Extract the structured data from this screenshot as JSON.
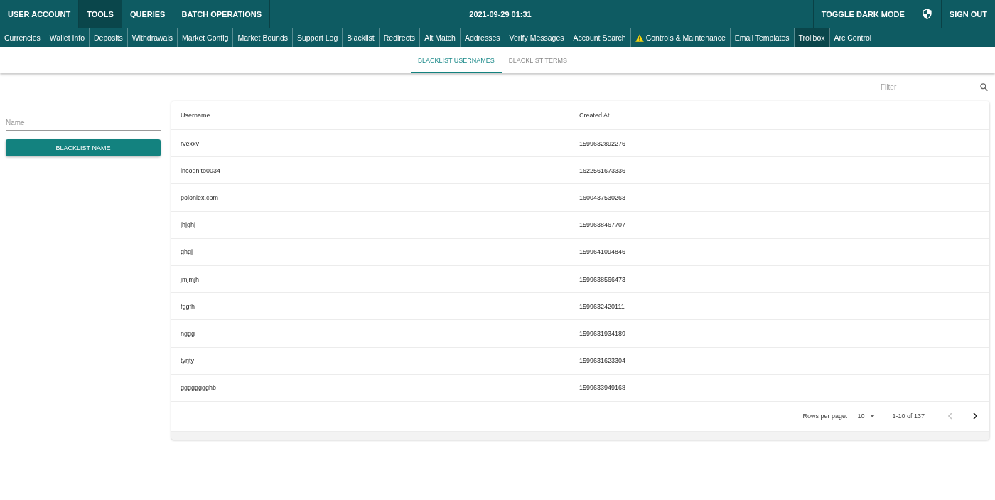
{
  "top_nav": {
    "items": [
      {
        "label": "USER ACCOUNT",
        "selected": false
      },
      {
        "label": "TOOLS",
        "selected": true
      },
      {
        "label": "QUERIES",
        "selected": false
      },
      {
        "label": "BATCH OPERATIONS",
        "selected": false
      }
    ],
    "datetime": "2021-09-29 01:31",
    "actions": [
      {
        "kind": "text",
        "label": "TOGGLE DARK MODE"
      },
      {
        "kind": "icon"
      },
      {
        "kind": "text",
        "label": "SIGN OUT"
      }
    ]
  },
  "sub_nav": {
    "items": [
      {
        "label": "Currencies",
        "selected": false,
        "alert": false
      },
      {
        "label": "Wallet Info",
        "selected": false,
        "alert": false
      },
      {
        "label": "Deposits",
        "selected": false,
        "alert": false
      },
      {
        "label": "Withdrawals",
        "selected": false,
        "alert": false
      },
      {
        "label": "Market Config",
        "selected": false,
        "alert": false
      },
      {
        "label": "Market Bounds",
        "selected": false,
        "alert": false
      },
      {
        "label": "Support Log",
        "selected": false,
        "alert": false
      },
      {
        "label": "Blacklist",
        "selected": false,
        "alert": false
      },
      {
        "label": "Redirects",
        "selected": false,
        "alert": false
      },
      {
        "label": "Alt Match",
        "selected": false,
        "alert": false
      },
      {
        "label": "Addresses",
        "selected": false,
        "alert": false
      },
      {
        "label": "Verify Messages",
        "selected": false,
        "alert": false
      },
      {
        "label": "Account Search",
        "selected": false,
        "alert": false
      },
      {
        "label": "Controls & Maintenance",
        "selected": false,
        "alert": true
      },
      {
        "label": "Email Templates",
        "selected": false,
        "alert": false
      },
      {
        "label": "Trollbox",
        "selected": true,
        "alert": false
      },
      {
        "label": "Arc Control",
        "selected": false,
        "alert": false
      }
    ]
  },
  "tabs": [
    {
      "label": "BLACKLIST USERNAMES",
      "selected": true
    },
    {
      "label": "BLACKLIST TERMS",
      "selected": false
    }
  ],
  "filter": {
    "placeholder": "Filter"
  },
  "form": {
    "name_field": {
      "placeholder": "Name"
    },
    "submit_button": "BLACKLIST NAME"
  },
  "table": {
    "columns": [
      "Username",
      "Created At"
    ],
    "rows": [
      [
        "rvexxv",
        "1599632892276"
      ],
      [
        "incognito0034",
        "1622561673336"
      ],
      [
        "poloniex.com",
        "1600437530263"
      ],
      [
        "jhjghj",
        "1599638467707"
      ],
      [
        "ghgj",
        "1599641094846"
      ],
      [
        "jmjmjh",
        "1599638566473"
      ],
      [
        "fggfh",
        "1599632420111"
      ],
      [
        "nggg",
        "1599631934189"
      ],
      [
        "tyrjty",
        "1599631623304"
      ],
      [
        "gggggggghb",
        "1599633949168"
      ]
    ],
    "pagination": {
      "label": "Rows per page:",
      "rows_per_page": "10",
      "range": "1-10 of 137",
      "prev_disabled": true,
      "next_disabled": false
    }
  }
}
